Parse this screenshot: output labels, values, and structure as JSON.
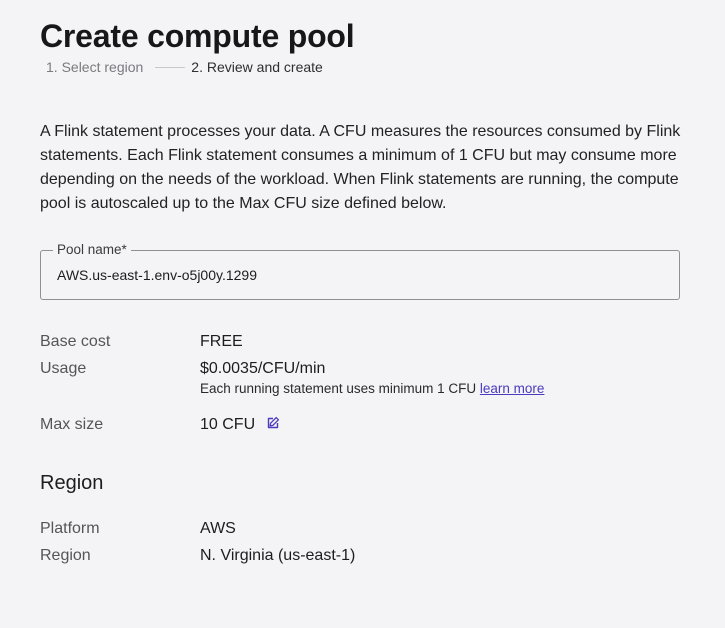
{
  "page": {
    "title": "Create compute pool"
  },
  "stepper": {
    "step1": "1. Select region",
    "step2": "2. Review and create"
  },
  "intro": {
    "text": "A Flink statement processes your data. A CFU measures the resources consumed by Flink statements. Each Flink statement consumes a minimum of 1 CFU but may consume more depending on the needs of the workload. When Flink statements are running, the compute pool is autoscaled up to the Max CFU size defined below."
  },
  "pool_name": {
    "label": "Pool name*",
    "value": "AWS.us-east-1.env-o5j00y.1299"
  },
  "pricing": {
    "base_cost_label": "Base cost",
    "base_cost_value": "FREE",
    "usage_label": "Usage",
    "usage_value": "$0.0035/CFU/min",
    "usage_note": "Each running statement uses minimum 1 CFU",
    "learn_more": "learn more",
    "max_size_label": "Max size",
    "max_size_value": "10 CFU",
    "edit_icon": "edit-icon"
  },
  "region": {
    "heading": "Region",
    "platform_label": "Platform",
    "platform_value": "AWS",
    "region_label": "Region",
    "region_value": "N. Virginia (us-east-1)"
  },
  "colors": {
    "background": "#f4f3f5",
    "link": "#4b3bbf",
    "text": "#1d1d20",
    "muted": "#555559"
  }
}
